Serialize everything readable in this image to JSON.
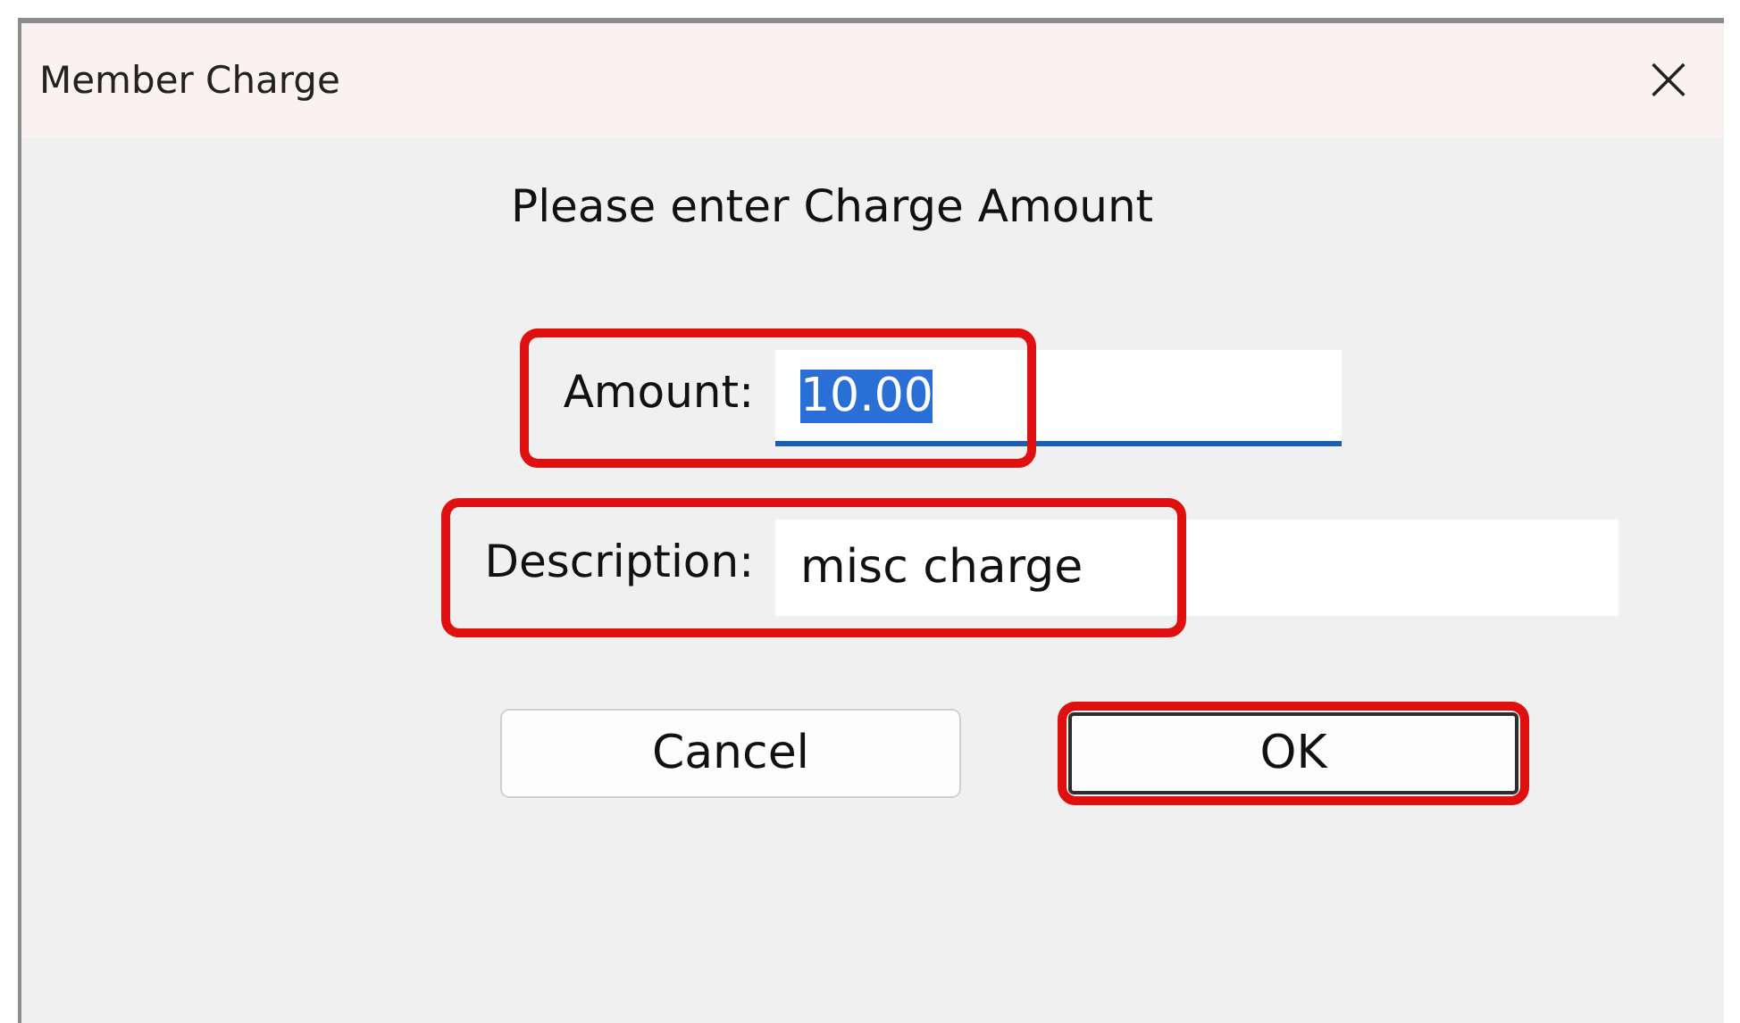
{
  "window": {
    "title": "Member Charge",
    "close": "×"
  },
  "prompt": "Please enter Charge Amount",
  "fields": [
    {
      "label": "Amount:",
      "value": "10.00",
      "focused": true,
      "highlighted": true
    },
    {
      "label": "Description:",
      "value": "misc charge",
      "focused": false,
      "highlighted": true
    }
  ],
  "buttons": [
    {
      "label": "Cancel",
      "default": false,
      "highlighted": false
    },
    {
      "label": "OK",
      "default": true,
      "highlighted": true
    }
  ]
}
